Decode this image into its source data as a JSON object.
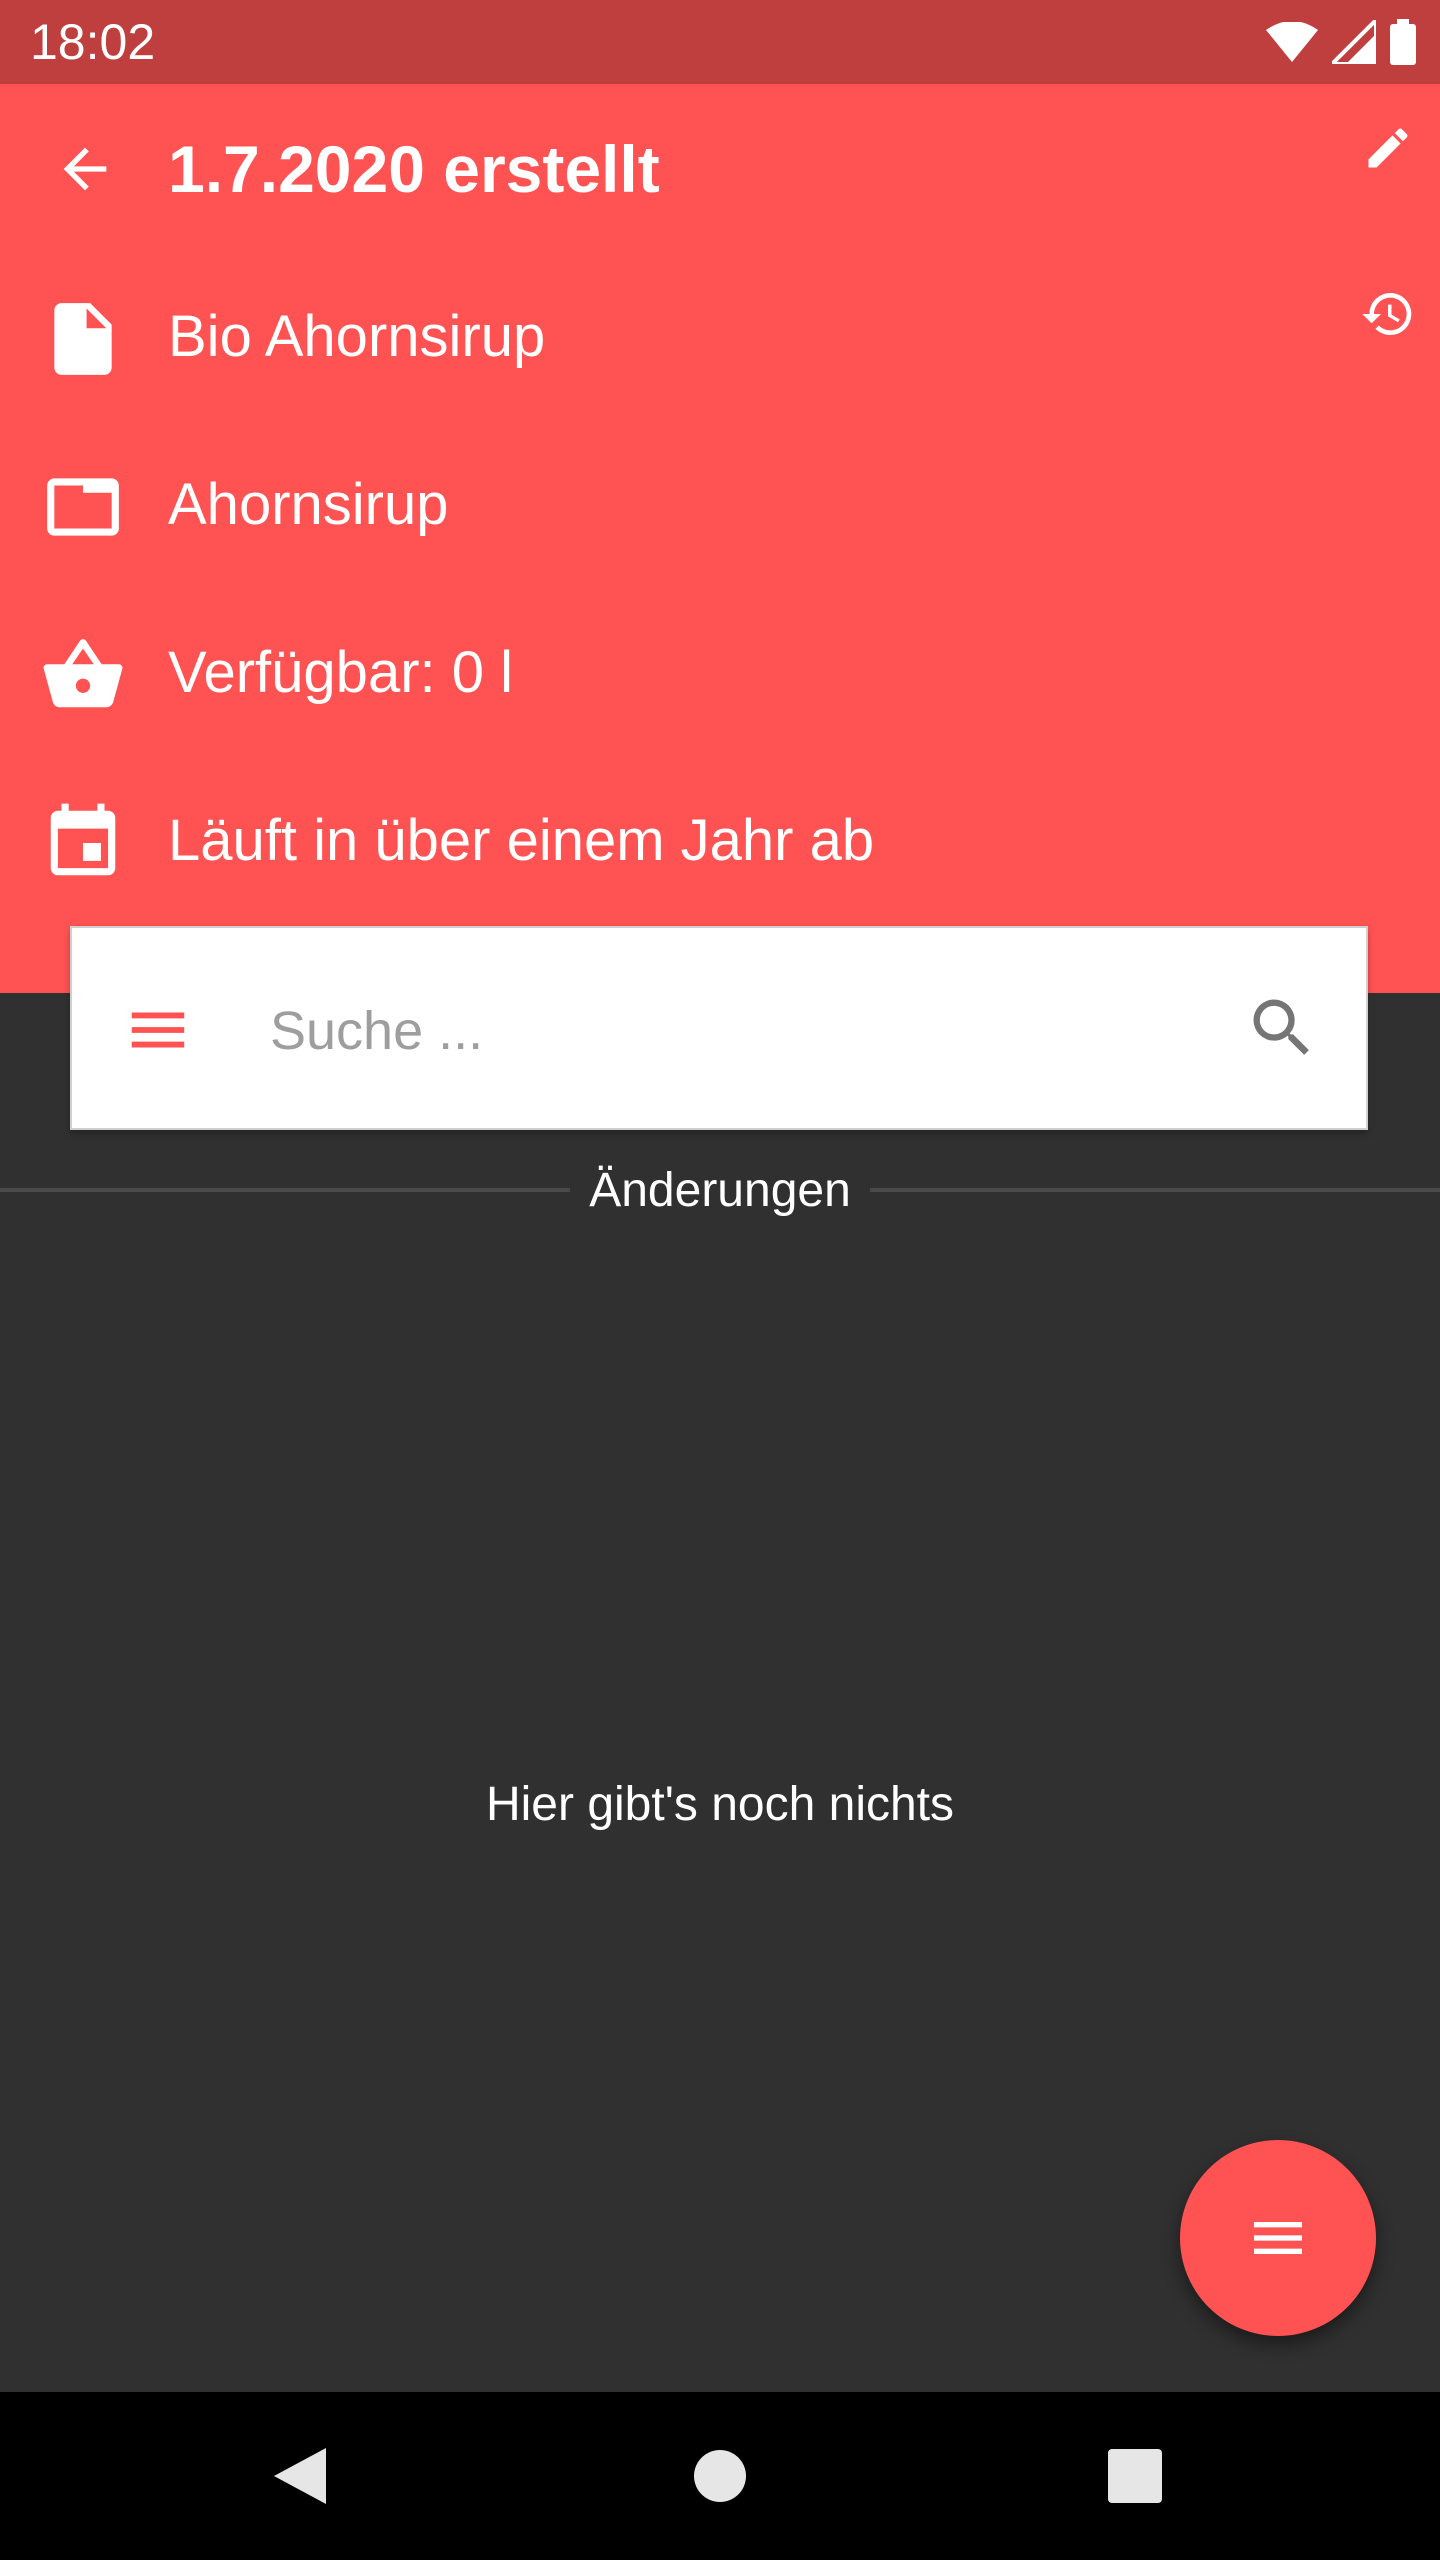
{
  "status_bar": {
    "time": "18:02",
    "icons": [
      "wifi-icon",
      "signal-icon",
      "battery-icon"
    ]
  },
  "header": {
    "title": "1.7.2020 erstellt",
    "back_icon": "arrow-back-icon",
    "edit_icon": "pencil-icon",
    "history_icon": "history-icon",
    "rows": [
      {
        "icon": "document-icon",
        "label": "Bio Ahornsirup"
      },
      {
        "icon": "folder-icon",
        "label": "Ahornsirup"
      },
      {
        "icon": "basket-icon",
        "label": "Verfügbar: 0 l"
      },
      {
        "icon": "calendar-icon",
        "label": "Läuft in über einem Jahr ab"
      }
    ]
  },
  "search": {
    "placeholder": "Suche ...",
    "value": ""
  },
  "section": {
    "label": "Änderungen"
  },
  "empty_state": {
    "text": "Hier gibt's noch nichts"
  },
  "fab": {
    "icon": "menu-icon"
  },
  "navigation": {
    "buttons": [
      "back-triangle-icon",
      "home-circle-icon",
      "recents-square-icon"
    ]
  },
  "colors": {
    "accent": "#ff5252",
    "status_bar": "#bf3f3f",
    "background": "#303030"
  }
}
